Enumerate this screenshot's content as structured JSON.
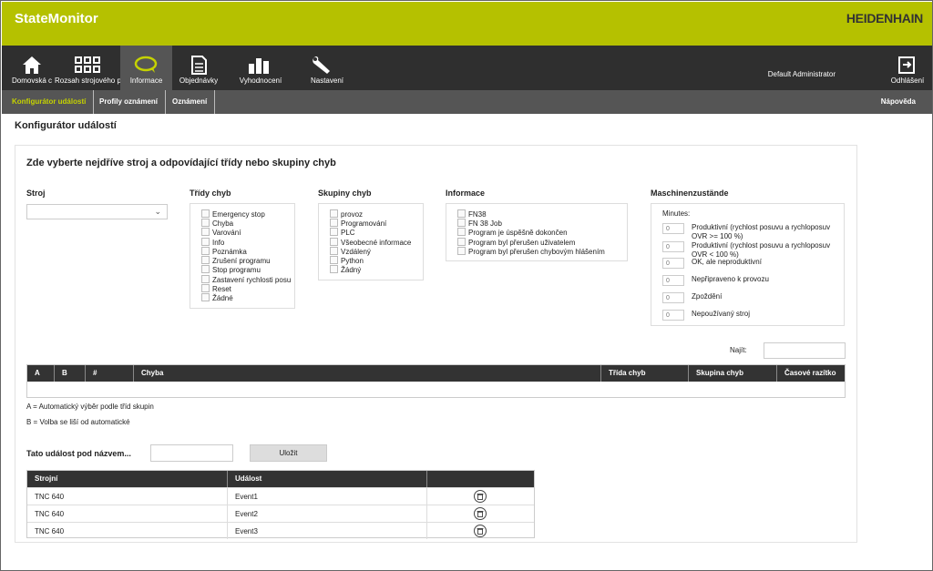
{
  "app": {
    "title": "StateMonitor",
    "brand": "HEIDENHAIN",
    "accent": "#b5c100"
  },
  "nav": {
    "items": [
      {
        "label": "Domovská c",
        "icon": "home-icon"
      },
      {
        "label": "Rozsah strojového p",
        "icon": "grid-icon"
      },
      {
        "label": "Informace",
        "icon": "speech-bubble-icon"
      },
      {
        "label": "Objednávky",
        "icon": "document-icon"
      },
      {
        "label": "Vyhodnocení",
        "icon": "bar-chart-icon"
      },
      {
        "label": "Nastavení",
        "icon": "wrench-icon"
      }
    ],
    "user": "Default Administrator",
    "logout": "Odhlášení"
  },
  "subnav": {
    "items": [
      "Konfigurátor událostí",
      "Profily oznámení",
      "Oznámení"
    ],
    "help": "Nápověda"
  },
  "page": {
    "title": "Konfigurátor událostí",
    "intro": "Zde vyberte nejdříve stroj a odpovídající třídy nebo skupiny chyb"
  },
  "filters": {
    "stroj_label": "Stroj",
    "tridy_label": "Třídy chyb",
    "tridy": [
      "Emergency stop",
      "Chyba",
      "Varování",
      "Info",
      "Poznámka",
      "Zrušení programu",
      "Stop programu",
      "Zastavení rychlosti posu",
      "Reset",
      "Žádné"
    ],
    "skupiny_label": "Skupiny chyb",
    "skupiny": [
      "provoz",
      "Programování",
      "PLC",
      "Všeobecné informace",
      "Vzdálený",
      "Python",
      "Žádný"
    ],
    "informace_label": "Informace",
    "informace": [
      "FN38",
      "FN 38 Job",
      "Program je úspěšně dokončen",
      "Program byl přerušen uživatelem",
      "Program byl přerušen chybovým hlášením"
    ],
    "stav_label": "Maschinenzustände",
    "minutes_label": "Minutes:",
    "stavy": [
      {
        "value": "0",
        "label": "Produktivní (rychlost posuvu a rychloposuv OVR >= 100 %)"
      },
      {
        "value": "0",
        "label": "Produktivní (rychlost posuvu a rychloposuv OVR < 100 %)"
      },
      {
        "value": "0",
        "label": "OK, ale neproduktivní"
      },
      {
        "value": "0",
        "label": "Nepřipraveno k provozu"
      },
      {
        "value": "0",
        "label": "Zpoždění"
      },
      {
        "value": "0",
        "label": "Nepoužívaný stroj"
      }
    ]
  },
  "search": {
    "label": "Najít:",
    "value": ""
  },
  "error_table": {
    "columns": [
      "A",
      "B",
      "#",
      "Chyba",
      "Třída chyb",
      "Skupina chyb",
      "Časové razítko"
    ],
    "rows": []
  },
  "legend": {
    "a": "A = Automatický výběr podle tříd skupin",
    "b": "B = Volba se liší od automatické"
  },
  "save": {
    "label": "Tato událost pod názvem...",
    "name_value": "",
    "button": "Uložit"
  },
  "events_table": {
    "columns": [
      "Strojní",
      "Událost",
      ""
    ],
    "rows": [
      {
        "machine": "TNC 640",
        "event": "Event1"
      },
      {
        "machine": "TNC 640",
        "event": "Event2"
      },
      {
        "machine": "TNC 640",
        "event": "Event3"
      }
    ]
  }
}
